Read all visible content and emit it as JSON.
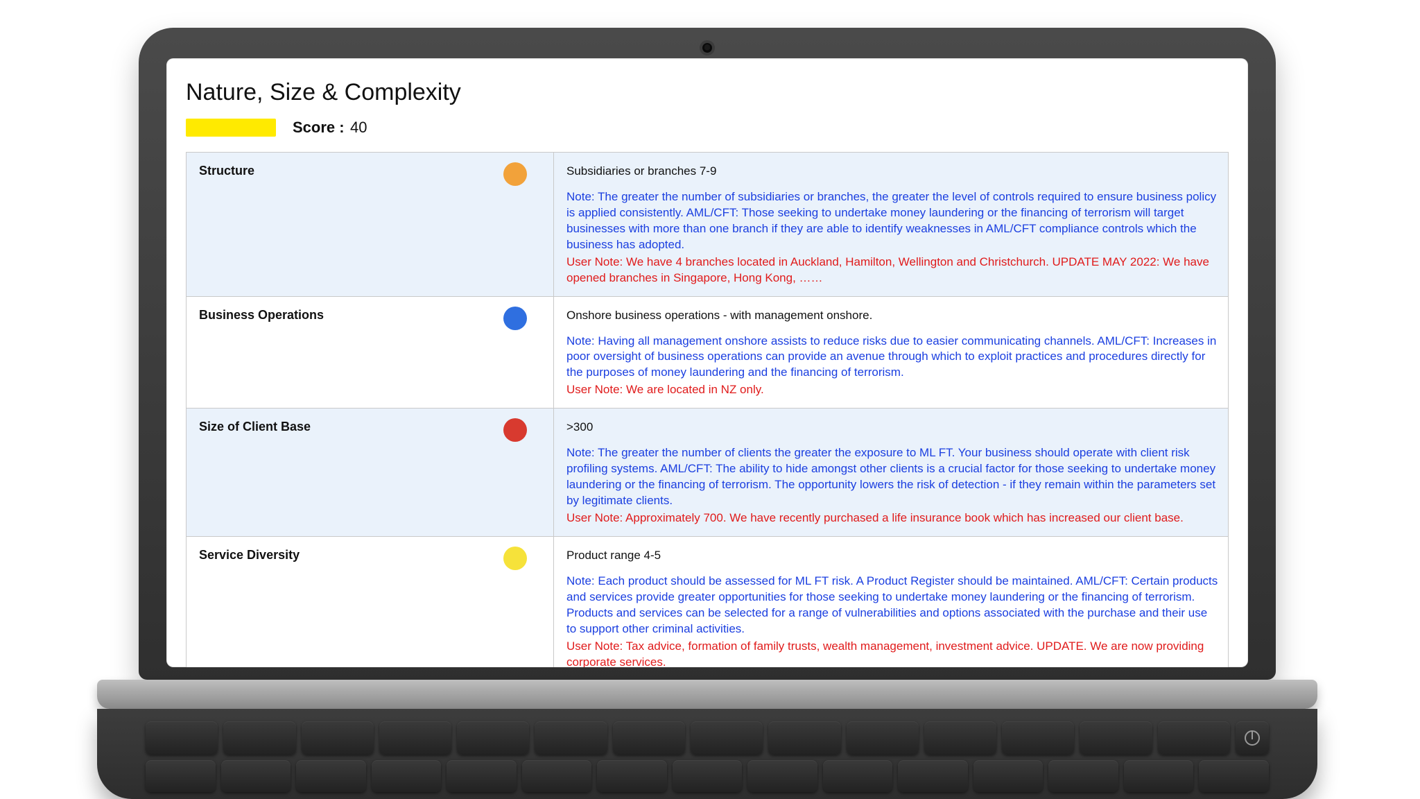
{
  "page": {
    "title": "Nature, Size & Complexity",
    "score_label": "Score :",
    "score_value": "40",
    "swatch_color": "#ffea00"
  },
  "rows": [
    {
      "category": "Structure",
      "dot_color": "orange",
      "summary": "Subsidiaries or branches 7-9",
      "note": "Note: The greater the number of subsidiaries or branches, the greater the level of controls required to ensure business policy is applied consistently. AML/CFT: Those seeking to undertake money laundering or the financing of terrorism will target businesses with more than one branch if they are able to identify weaknesses in AML/CFT compliance controls which the business has adopted.",
      "user_note": "User Note: We have 4 branches located in Auckland, Hamilton, Wellington and Christchurch. UPDATE MAY 2022: We have opened branches in Singapore, Hong Kong, ……"
    },
    {
      "category": "Business Operations",
      "dot_color": "blue",
      "summary": "Onshore business operations - with management onshore.",
      "note": "Note: Having all management onshore assists to reduce risks due to easier communicating channels. AML/CFT: Increases in poor oversight of business operations can provide an avenue through which to exploit practices and procedures directly for the purposes of money laundering and the financing of terrorism.",
      "user_note": "User Note: We are located in NZ only."
    },
    {
      "category": "Size of Client Base",
      "dot_color": "red",
      "summary": ">300",
      "note": "Note: The greater the number of clients the greater the exposure to ML FT. Your business should operate with client risk profiling systems. AML/CFT: The ability to hide amongst other clients is a crucial factor for those seeking to undertake money laundering or the financing of terrorism. The opportunity lowers the risk of detection - if they remain within the parameters set by legitimate clients.",
      "user_note": "User Note: Approximately 700. We have recently purchased a life insurance book which has increased our client base."
    },
    {
      "category": "Service Diversity",
      "dot_color": "yellow",
      "summary": "Product range 4-5",
      "note": "Note: Each product should be assessed for ML FT risk. A Product Register should be maintained. AML/CFT: Certain products and services provide greater opportunities for those seeking to undertake money laundering or the financing of terrorism. Products and services can be selected for a range of vulnerabilities and options associated with the purchase and their use to support other criminal activities.",
      "user_note": "User Note: Tax advice, formation of family trusts, wealth management, investment advice. UPDATE. We are now providing corporate services."
    }
  ]
}
